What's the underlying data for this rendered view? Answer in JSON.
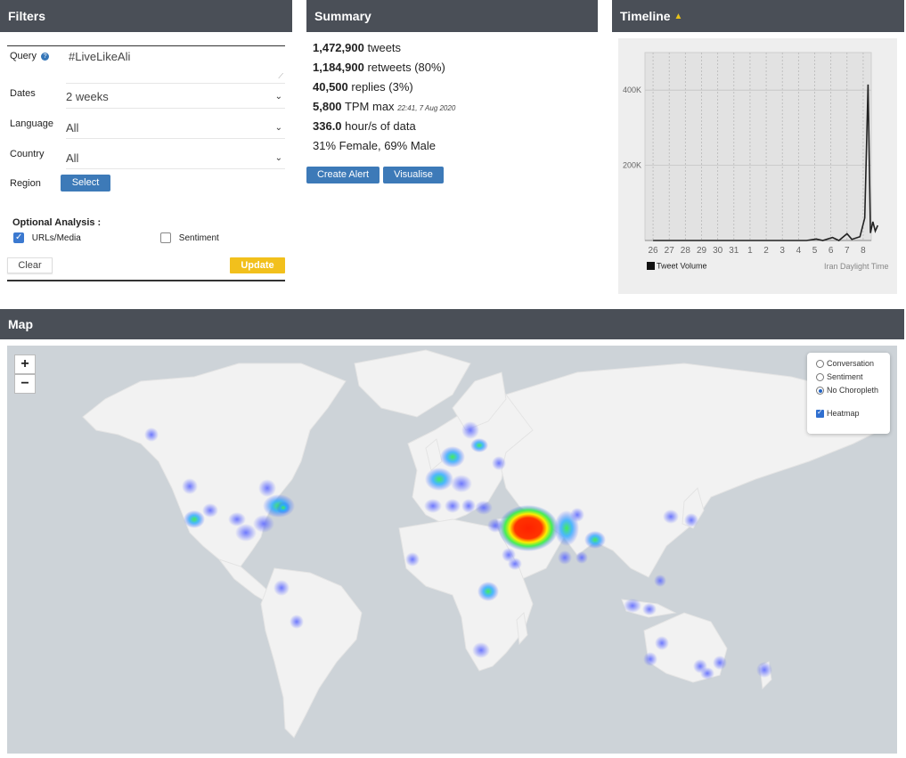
{
  "filters": {
    "title": "Filters",
    "query_label": "Query",
    "query_help_icon": "question-circle-icon",
    "query_value": "#LiveLikeAli",
    "dates_label": "Dates",
    "dates_value": "2 weeks",
    "language_label": "Language",
    "language_value": "All",
    "country_label": "Country",
    "country_value": "All",
    "region_label": "Region",
    "region_button": "Select",
    "optional_label": "Optional Analysis :",
    "urls_label": "URLs/Media",
    "urls_checked": true,
    "sentiment_label": "Sentiment",
    "sentiment_checked": false,
    "clear_button": "Clear",
    "update_button": "Update"
  },
  "summary": {
    "title": "Summary",
    "tweets_num": "1,472,900",
    "tweets_txt": "tweets",
    "retweets_num": "1,184,900",
    "retweets_txt": "retweets (80%)",
    "replies_num": "40,500",
    "replies_txt": "replies (3%)",
    "tpm_num": "5,800",
    "tpm_txt": "TPM max",
    "tpm_time": "22:41, 7 Aug 2020",
    "hours_num": "336.0",
    "hours_txt": "hour/s of data",
    "gender_text": "31% Female, 69% Male",
    "create_alert_button": "Create Alert",
    "visualise_button": "Visualise"
  },
  "timeline": {
    "title": "Timeline",
    "warning_icon": "warning-icon",
    "legend_label": "Tweet Volume",
    "timezone_label": "Iran Daylight Time"
  },
  "chart_data": {
    "type": "line",
    "x": [
      "26",
      "27",
      "28",
      "29",
      "30",
      "31",
      "1",
      "2",
      "3",
      "4",
      "5",
      "6",
      "7",
      "8"
    ],
    "series": [
      {
        "name": "Tweet Volume",
        "points": [
          [
            0,
            0
          ],
          [
            9.5,
            0
          ],
          [
            10.1,
            4000
          ],
          [
            10.5,
            0
          ],
          [
            11.1,
            8000
          ],
          [
            11.5,
            0
          ],
          [
            12.0,
            18000
          ],
          [
            12.3,
            3000
          ],
          [
            12.8,
            10000
          ],
          [
            13.1,
            60000
          ],
          [
            13.3,
            415000
          ],
          [
            13.45,
            20000
          ],
          [
            13.6,
            50000
          ],
          [
            13.75,
            25000
          ],
          [
            13.9,
            40000
          ]
        ]
      }
    ],
    "y_ticks": [
      "200K",
      "400K"
    ],
    "ylim": [
      0,
      500000
    ],
    "grid": true,
    "legend_position": "bottom-left",
    "color": "#222222"
  },
  "map": {
    "title": "Map",
    "zoom_in": "+",
    "zoom_out": "−",
    "layer_options": [
      "Conversation",
      "Sentiment",
      "No Choropleth"
    ],
    "selected_layer": "No Choropleth",
    "heatmap_label": "Heatmap",
    "heatmap_checked": true
  },
  "colors": {
    "header_bg": "#4a4f57",
    "button_blue": "#3d7ab8",
    "update_yellow": "#f2c01c",
    "map_ocean": "#cdd3d8",
    "map_land": "#f2f2f2"
  }
}
